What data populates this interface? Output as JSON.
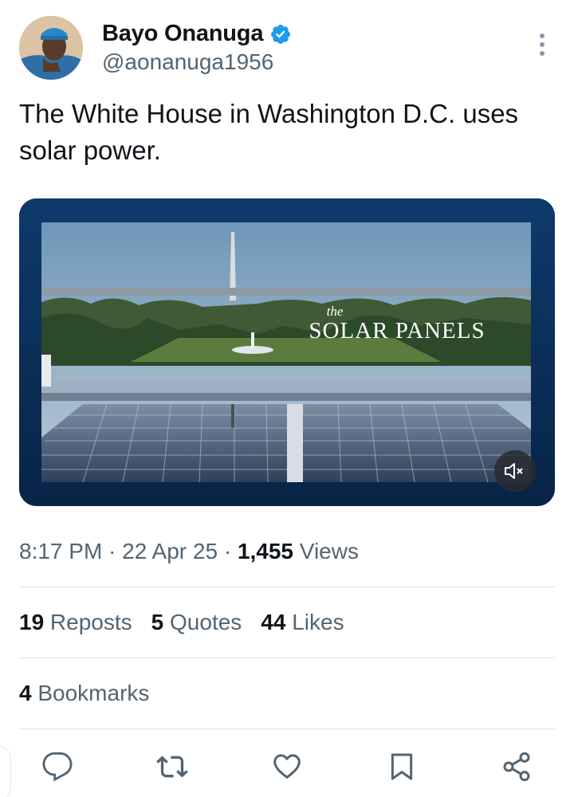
{
  "author": {
    "display_name": "Bayo Onanuga",
    "handle": "@aonanuga1956",
    "verified": true
  },
  "tweet": {
    "text": "The White House in Washington D.C. uses solar power."
  },
  "media": {
    "overlay_small": "the",
    "overlay_title": "SOLAR PANELS",
    "muted": true
  },
  "meta": {
    "time": "8:17 PM",
    "sep1": " · ",
    "date": "22 Apr 25",
    "sep2": " · ",
    "views_count": "1,455",
    "views_label": " Views"
  },
  "stats": {
    "reposts_count": "19",
    "reposts_label": " Reposts",
    "quotes_count": "5",
    "quotes_label": " Quotes",
    "likes_count": "44",
    "likes_label": " Likes",
    "bookmarks_count": "4",
    "bookmarks_label": " Bookmarks"
  },
  "icons": {
    "reply": "reply-icon",
    "repost": "repost-icon",
    "like": "like-icon",
    "bookmark": "bookmark-icon",
    "share": "share-icon"
  },
  "colors": {
    "text": "#0f1419",
    "secondary": "#536471",
    "accent": "#1d9bf0",
    "icon": "#536471",
    "media_frame": "#0c2d57"
  }
}
